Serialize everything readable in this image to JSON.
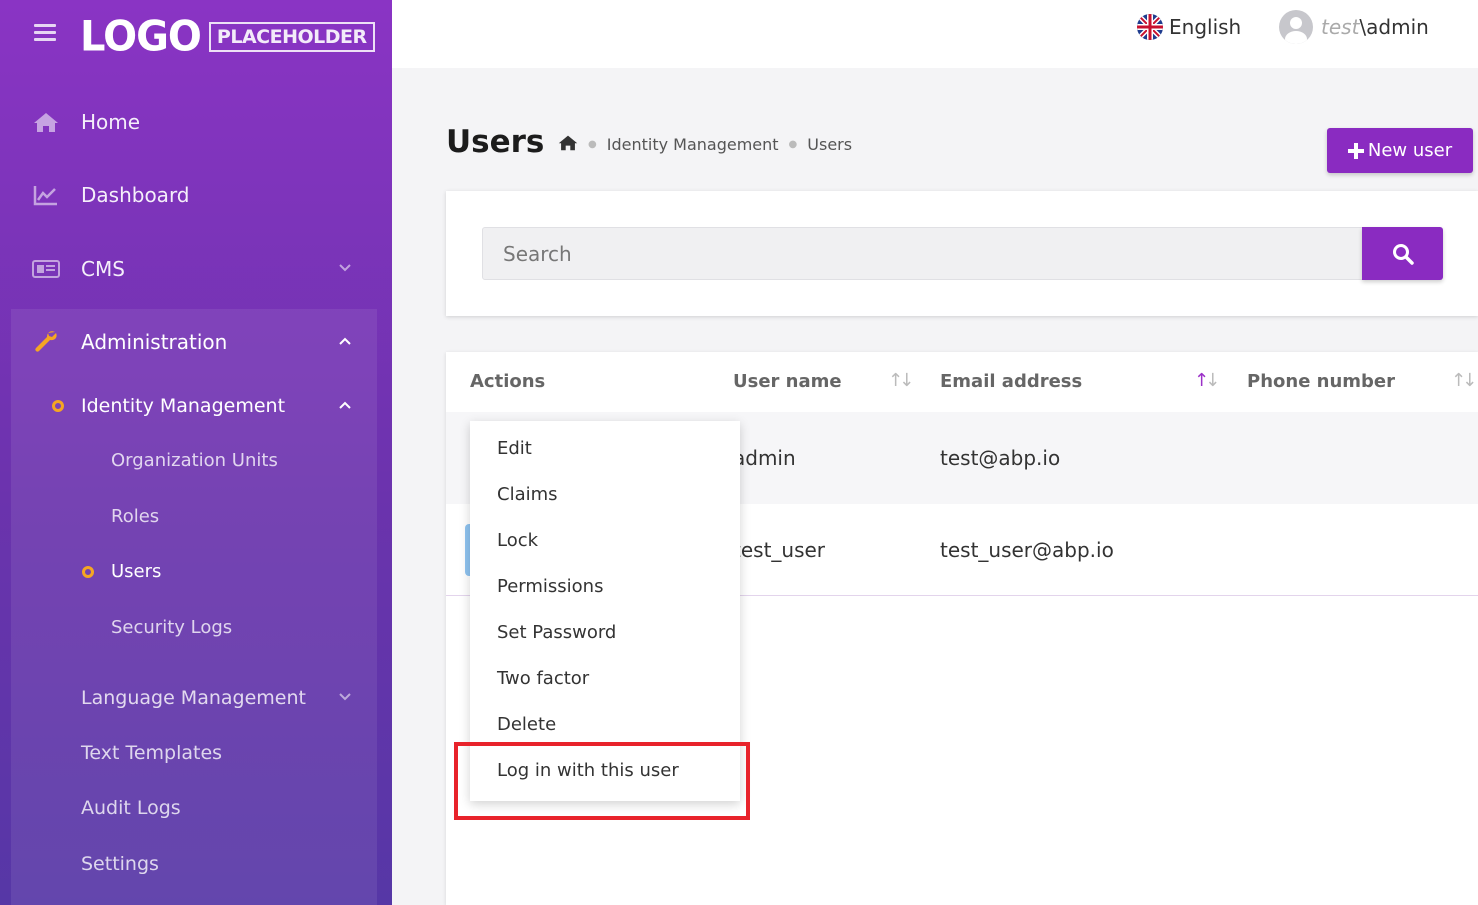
{
  "logo": {
    "main": "LOGO",
    "sub": "PLACEHOLDER"
  },
  "sidebar": {
    "home": "Home",
    "dashboard": "Dashboard",
    "cms": "CMS",
    "administration": "Administration",
    "identity_management": "Identity Management",
    "organization_units": "Organization Units",
    "roles": "Roles",
    "users": "Users",
    "security_logs": "Security Logs",
    "language_management": "Language Management",
    "text_templates": "Text Templates",
    "audit_logs": "Audit Logs",
    "settings": "Settings"
  },
  "topbar": {
    "language": "English",
    "tenant": "test",
    "separator": "\\",
    "username": "admin"
  },
  "page": {
    "title": "Users",
    "breadcrumb": [
      "Identity Management",
      "Users"
    ],
    "new_user": "New user"
  },
  "search": {
    "placeholder": "Search"
  },
  "table": {
    "headers": {
      "actions": "Actions",
      "username": "User name",
      "email": "Email address",
      "phone": "Phone number"
    },
    "rows": [
      {
        "username": "admin",
        "email": "test@abp.io"
      },
      {
        "username": "test_user",
        "email": "test_user@abp.io"
      }
    ]
  },
  "dropdown": {
    "items": [
      "Edit",
      "Claims",
      "Lock",
      "Permissions",
      "Set Password",
      "Two factor",
      "Delete",
      "Log in with this user"
    ]
  },
  "colors": {
    "primary": "#8a2bc1",
    "highlight": "#e8232b",
    "accent_dot": "#f5a623"
  }
}
